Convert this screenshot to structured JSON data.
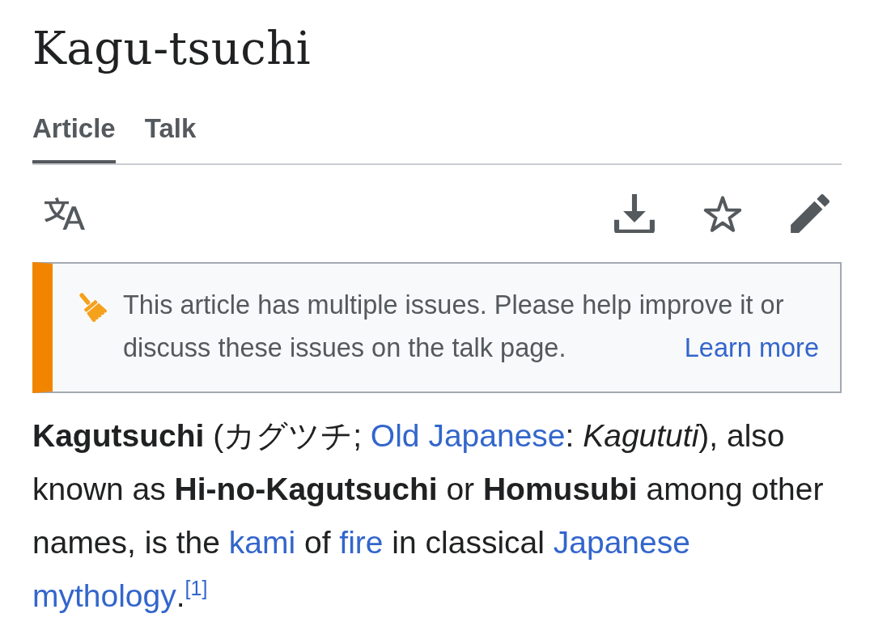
{
  "title": "Kagu-tsuchi",
  "tabs": [
    {
      "label": "Article",
      "selected": true
    },
    {
      "label": "Talk",
      "selected": false
    }
  ],
  "notice": {
    "text": "This article has multiple issues. Please help improve it or discuss these issues on the talk page.",
    "link": "Learn more"
  },
  "paragraph": [
    {
      "kind": "bold",
      "text": "Kagutsuchi"
    },
    {
      "kind": "text",
      "text": " (カグツチ; "
    },
    {
      "kind": "link",
      "text": "Old Japanese"
    },
    {
      "kind": "text",
      "text": ": "
    },
    {
      "kind": "italic",
      "text": "Kagututi"
    },
    {
      "kind": "text",
      "text": "), also known as "
    },
    {
      "kind": "bold",
      "text": "Hi-no-Kagutsuchi"
    },
    {
      "kind": "text",
      "text": " or "
    },
    {
      "kind": "bold",
      "text": "Homusubi"
    },
    {
      "kind": "text",
      "text": " among other names, is the "
    },
    {
      "kind": "link",
      "text": "kami"
    },
    {
      "kind": "text",
      "text": " of "
    },
    {
      "kind": "link",
      "text": "fire"
    },
    {
      "kind": "text",
      "text": " in classical "
    },
    {
      "kind": "link",
      "text": "Japanese "
    },
    {
      "kind": "link",
      "text": "mythology"
    },
    {
      "kind": "text",
      "text": "."
    },
    {
      "kind": "citation",
      "text": "[1]"
    }
  ]
}
